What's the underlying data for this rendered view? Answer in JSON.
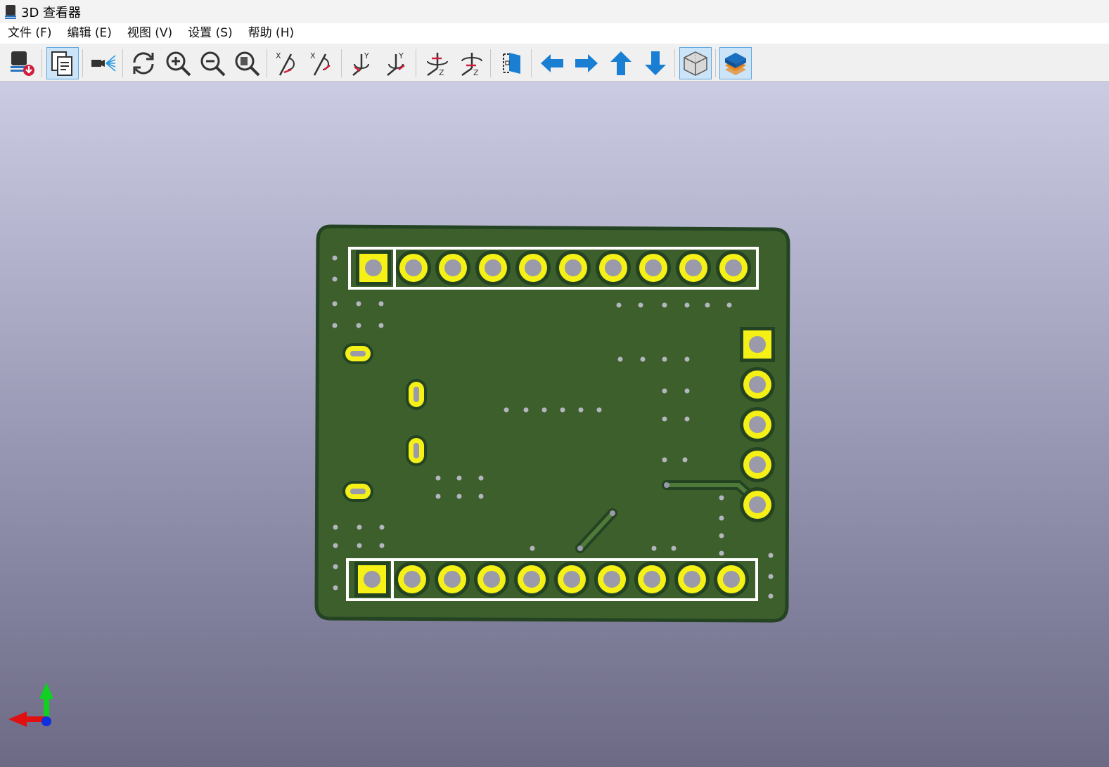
{
  "window": {
    "title": "3D 查看器"
  },
  "menu": {
    "file": "文件 (F)",
    "edit": "编辑 (E)",
    "view": "视图 (V)",
    "settings": "设置 (S)",
    "help": "帮助 (H)"
  },
  "toolbar": {
    "buttons": [
      "export-3d-icon",
      "copy-image-icon",
      "raytrace-icon",
      "reload-icon",
      "zoom-in-icon",
      "zoom-out-icon",
      "zoom-fit-icon",
      "rotate-x-cw-icon",
      "rotate-x-ccw-icon",
      "rotate-y-cw-icon",
      "rotate-y-ccw-icon",
      "rotate-z-cw-icon",
      "rotate-z-ccw-icon",
      "flip-board-icon",
      "pan-left-icon",
      "pan-right-icon",
      "pan-up-icon",
      "pan-down-icon",
      "orthographic-icon",
      "layers-icon"
    ],
    "active": [
      "copy-image-icon",
      "orthographic-icon",
      "layers-icon"
    ]
  },
  "colors": {
    "board": "#3c5f2c",
    "board_edge": "#244322",
    "pad_copper": "#f5f016",
    "silkscreen": "#ffffff",
    "drill": "#9a9aaa",
    "toolbar_blue": "#1a7fd3",
    "axis_x": "#e01010",
    "axis_y": "#10d020",
    "axis_z": "#1030e0"
  }
}
